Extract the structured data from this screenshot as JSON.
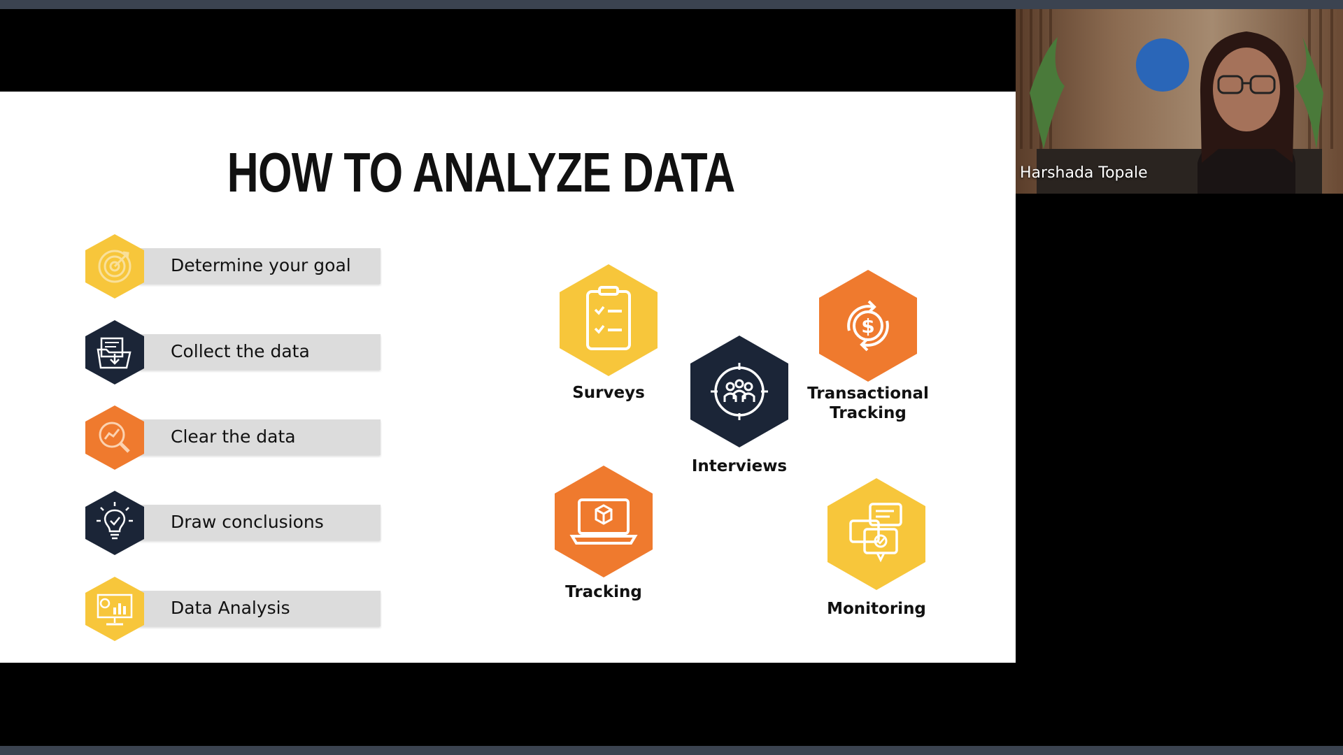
{
  "slide": {
    "title": "HOW TO ANALYZE DATA",
    "steps": [
      {
        "label": "Determine your goal",
        "color": "#f7c63b",
        "icon": "target-icon"
      },
      {
        "label": "Collect the data",
        "color": "#1b2537",
        "icon": "folder-download-icon"
      },
      {
        "label": "Clear the data",
        "color": "#ef7a2e",
        "icon": "magnifier-chart-icon"
      },
      {
        "label": "Draw conclusions",
        "color": "#1b2537",
        "icon": "lightbulb-icon"
      },
      {
        "label": "Data Analysis",
        "color": "#f7c63b",
        "icon": "monitor-chart-icon"
      }
    ],
    "methods": [
      {
        "label": "Surveys",
        "color": "#f7c63b",
        "icon": "clipboard-checklist-icon"
      },
      {
        "label": "Interviews",
        "color": "#1b2537",
        "icon": "group-target-icon"
      },
      {
        "label": "Transactional Tracking",
        "color": "#ef7a2e",
        "icon": "dollar-cycle-icon"
      },
      {
        "label": "Tracking",
        "color": "#ef7a2e",
        "icon": "laptop-box-icon"
      },
      {
        "label": "Monitoring",
        "color": "#f7c63b",
        "icon": "chat-monitor-icon"
      }
    ]
  },
  "video": {
    "participant_name": "Harshada Topale"
  },
  "colors": {
    "background": "#000000",
    "frame_bar": "#3b4350",
    "slide_bg": "#ffffff",
    "step_bar": "#dcdcdc"
  }
}
